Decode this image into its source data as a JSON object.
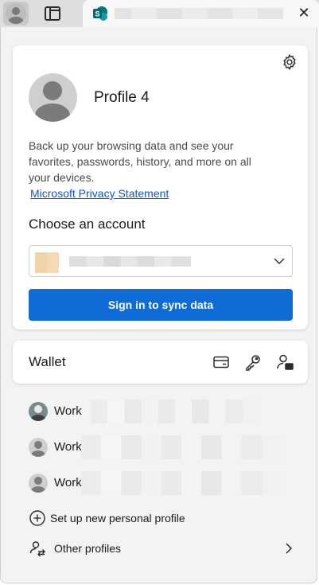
{
  "topbar": {
    "profile_icon": "profile-avatar-icon",
    "tabs_icon": "tab-actions-icon",
    "tab_favicon": "sharepoint-icon",
    "tab_close_glyph": "✕"
  },
  "profile": {
    "name": "Profile 4",
    "description": "Back up your browsing data and see your favorites, passwords, history, and more on all your devices.",
    "privacy_link": "Microsoft Privacy Statement",
    "choose_label": "Choose an account",
    "sync_button": "Sign in to sync data"
  },
  "wallet": {
    "label": "Wallet",
    "icons": [
      "credit-card-icon",
      "key-icon",
      "personal-info-icon"
    ]
  },
  "work_profiles": [
    {
      "name": "Work",
      "avatar": "photo"
    },
    {
      "name": "Work",
      "avatar": "default"
    },
    {
      "name": "Work",
      "avatar": "default"
    }
  ],
  "menu": {
    "new_profile": "Set up new personal profile",
    "other_profiles": "Other profiles"
  },
  "colors": {
    "accent": "#0f6cd6",
    "link": "#0b57d0"
  }
}
